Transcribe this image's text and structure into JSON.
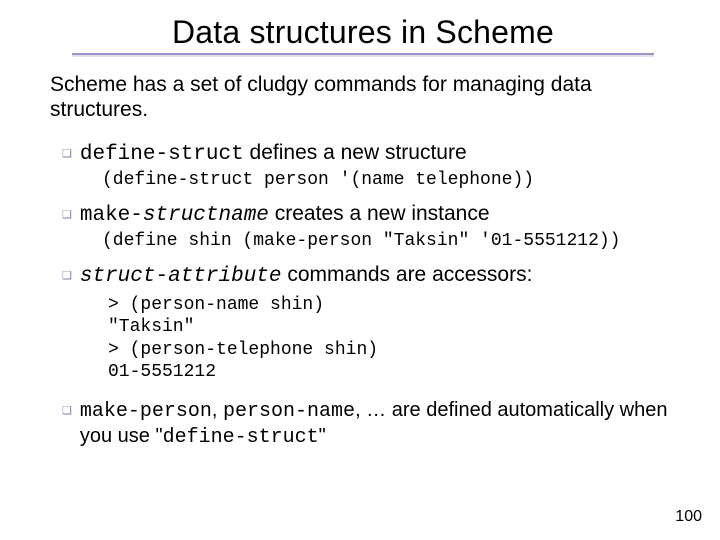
{
  "title": "Data structures in Scheme",
  "lead": "Scheme has a set of cludgy commands for managing data structures.",
  "b1": {
    "code": "define-struct",
    "tail": " defines a new structure",
    "example": "(define-struct person '(name telephone))"
  },
  "b2": {
    "make": "make-",
    "sn": "structname",
    "tail": " creates a new instance",
    "example": "(define shin (make-person \"Taksin\" '01-5551212))"
  },
  "b3": {
    "sa": "struct-attribute",
    "tail": " commands are accessors:",
    "block": "> (person-name shin)\n\"Taksin\"\n> (person-telephone shin)\n01-5551212"
  },
  "b4": {
    "mp": "make-person",
    "c1": ", ",
    "pn": "person-name",
    "mid": ", … are defined automatically when you use \"",
    "ds": "define-struct",
    "end": "\""
  },
  "page": "100"
}
